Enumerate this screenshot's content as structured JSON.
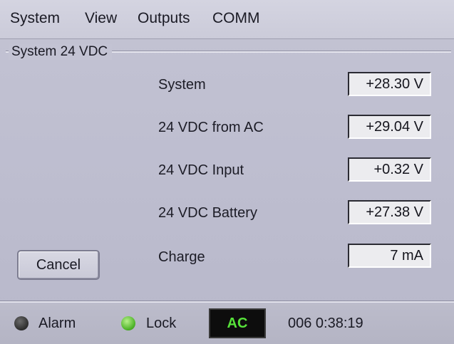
{
  "menu": [
    "System",
    "View",
    "Outputs",
    "COMM"
  ],
  "group": {
    "title": "System 24 VDC"
  },
  "rows": [
    {
      "label": "System",
      "value": "+28.30 V"
    },
    {
      "label": "24 VDC from AC",
      "value": "+29.04 V"
    },
    {
      "label": "24 VDC Input",
      "value": "+0.32 V"
    },
    {
      "label": "24 VDC Battery",
      "value": "+27.38 V"
    },
    {
      "label": "Charge",
      "value": "7 mA"
    }
  ],
  "buttons": {
    "cancel": "Cancel"
  },
  "status": {
    "alarm_label": "Alarm",
    "lock_label": "Lock",
    "power_source": "AC",
    "counter_time": "006 0:38:19",
    "alarm_led_color": "#3a3a3a",
    "lock_led_color": "#5cc635",
    "power_text_color": "#57e23a"
  }
}
